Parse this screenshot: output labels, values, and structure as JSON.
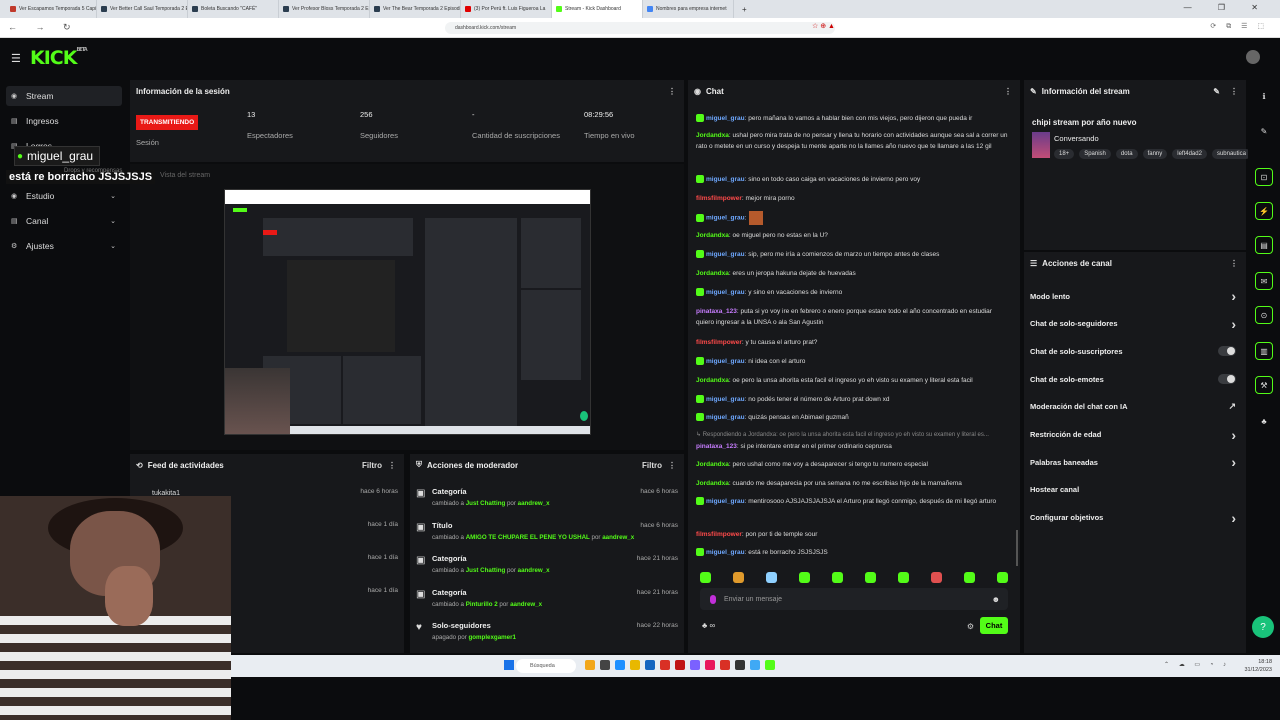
{
  "browser": {
    "tabs": [
      {
        "label": "Ver Escapamos Temporada 5 Capitulo",
        "color": "#c0392b"
      },
      {
        "label": "Ver Better Call Saul Temporada 2 Epi",
        "color": "#2c3e50"
      },
      {
        "label": "Boleta Buscando \"CAFÉ\"",
        "color": "#2c3e50"
      },
      {
        "label": "Ver Profesor Bloss Temporada 2 Epi",
        "color": "#2c3e50"
      },
      {
        "label": "Ver The Bear Temporada 2 Episodio",
        "color": "#2c3e50"
      },
      {
        "label": "(3) Por Perú ft. Luis Figueroa La",
        "color": "#e00000"
      },
      {
        "label": "Stream - Kick Dashboard",
        "color": "#53fc18",
        "active": true
      },
      {
        "label": "Nombres para empresa internet",
        "color": "#4285f4"
      }
    ],
    "new_tab": "+",
    "window_controls": "— ❐ ✕",
    "nav": "← → ↻",
    "url": "dashboard.kick.com/stream",
    "address_icons": "☆ ⊕ ▲",
    "extension_icons": "⟳ ⧉ ☰ ⬚"
  },
  "header": {
    "menu_icon": "☰",
    "logo": "KICK",
    "logo_sup": "BETA"
  },
  "sidebar": {
    "items": [
      {
        "label": "Stream",
        "icon": "◉",
        "selected": true,
        "chevron": ""
      },
      {
        "label": "Ingresos",
        "icon": "▤",
        "selected": false,
        "chevron": ""
      },
      {
        "label": "Logros",
        "icon": "▤",
        "selected": false,
        "chevron": ""
      },
      {
        "label": "Estudio",
        "icon": "◉",
        "selected": false,
        "chevron": "⌄"
      },
      {
        "label": "Canal",
        "icon": "▤",
        "selected": false,
        "chevron": "⌄"
      },
      {
        "label": "Ajustes",
        "icon": "⚙",
        "selected": false,
        "chevron": "⌄"
      }
    ]
  },
  "overlay": {
    "username": "miguel_grau",
    "message": "está re borracho JSJSJSJS",
    "partial_label": "Drops y recompensas",
    "partial_label2": "Vista del stream"
  },
  "session": {
    "title": "Información de la sesión",
    "menu": "⋮",
    "live_badge": "TRANSMITIENDO",
    "live_label": "Sesión",
    "stats": [
      {
        "value": "13",
        "label": "Espectadores"
      },
      {
        "value": "256",
        "label": "Seguidores"
      },
      {
        "value": "-",
        "label": "Cantidad de suscripciones"
      },
      {
        "value": "08:29:56",
        "label": "Tiempo en vivo"
      }
    ]
  },
  "feed": {
    "title": "Feed de actividades",
    "filter": "Filtro",
    "menu": "⋮",
    "rows": [
      {
        "name": "tukakita1",
        "time": "hace 6 horas"
      },
      {
        "name": "",
        "time": "hace 1 día"
      },
      {
        "name": "",
        "time": "hace 1 día"
      },
      {
        "name": "",
        "time": "hace 1 día"
      }
    ]
  },
  "moderator": {
    "title": "Acciones de moderador",
    "filter": "Filtro",
    "menu": "⋮",
    "rows": [
      {
        "icon": "▣",
        "title": "Categoría",
        "pre": "cambiado a ",
        "value": "Just Chatting",
        "mid": " por ",
        "user": "aandrew_x",
        "time": "hace 6 horas"
      },
      {
        "icon": "▣",
        "title": "Título",
        "pre": "cambiado a ",
        "value": "AMIGO TE CHUPARE EL PENE YO USHAL",
        "mid": " por ",
        "user": "aandrew_x",
        "time": "hace 6 horas"
      },
      {
        "icon": "▣",
        "title": "Categoría",
        "pre": "cambiado a ",
        "value": "Just Chatting",
        "mid": " por ",
        "user": "aandrew_x",
        "time": "hace 21 horas"
      },
      {
        "icon": "▣",
        "title": "Categoría",
        "pre": "cambiado a ",
        "value": "Pinturillo 2",
        "mid": " por ",
        "user": "aandrew_x",
        "time": "hace 21 horas"
      },
      {
        "icon": "♥",
        "title": "Solo-seguidores",
        "pre": "apagado por ",
        "value": "gomplexgamer1",
        "mid": "",
        "user": "",
        "time": "hace 22 horas"
      }
    ]
  },
  "chat": {
    "title": "Chat",
    "menu": "⋮",
    "messages": [
      {
        "user": "miguel_grau",
        "color": "#6ea8ff",
        "badge": true,
        "text": ": pero mañana lo vamos a hablar bien con mis viejos, pero dijeron que pueda ir"
      },
      {
        "user": "Jordandxa",
        "color": "#53fc18",
        "badge": false,
        "text": ": ushal pero mira trata de no pensar y llena tu horario con actividades aunque sea sal a correr un rato o metete en un curso y despeja tu mente aparte no la llames año nuevo que te llamare a las 12 gil"
      },
      {
        "user": "miguel_grau",
        "color": "#6ea8ff",
        "badge": true,
        "text": ": sino en todo caso caiga en vacaciones de invierno pero voy"
      },
      {
        "user": "filmsfilmpower",
        "color": "#ff4a4a",
        "badge": false,
        "text": ": mejor mira porno"
      },
      {
        "user": "miguel_grau",
        "color": "#6ea8ff",
        "badge": true,
        "text": ":"
      },
      {
        "user": "Jordandxa",
        "color": "#53fc18",
        "badge": false,
        "text": ": oe miguel pero no estas en la U?"
      },
      {
        "user": "miguel_grau",
        "color": "#6ea8ff",
        "badge": true,
        "text": ": sip, pero me iría a comienzos de marzo un tiempo antes de clases"
      },
      {
        "user": "Jordandxa",
        "color": "#53fc18",
        "badge": false,
        "text": ": eres un jeropa hakuna dejate de huevadas"
      },
      {
        "user": "miguel_grau",
        "color": "#6ea8ff",
        "badge": true,
        "text": ": y sino en vacaciones de invierno"
      },
      {
        "user": "pinataxa_123",
        "color": "#c77dff",
        "badge": false,
        "text": ": puta si yo voy ire en febrero o enero porque estare todo el año concentrado en estudiar quiero ingresar a la UNSA o ala San Agustin"
      },
      {
        "user": "filmsfilmpower",
        "color": "#ff4a4a",
        "badge": false,
        "text": ": y tu causa el arturo prat?"
      },
      {
        "user": "miguel_grau",
        "color": "#6ea8ff",
        "badge": true,
        "text": ": ni idea con el arturo"
      },
      {
        "user": "Jordandxa",
        "color": "#53fc18",
        "badge": false,
        "text": ": oe pero la unsa ahorita esta facil el ingreso yo eh visto su examen y literal esta facil"
      },
      {
        "user": "miguel_grau",
        "color": "#6ea8ff",
        "badge": true,
        "text": ": no podés tener el número de Arturo prat down xd"
      },
      {
        "user": "miguel_grau",
        "color": "#6ea8ff",
        "badge": true,
        "text": ": quizás pensas en Abimael guzmañ"
      },
      {
        "user": "pinataxa_123",
        "color": "#c77dff",
        "badge": false,
        "text": ": si pe intentare entrar en el primer ordinario ceprunsa",
        "reply": "↳ Respondiendo a Jordandxa: oe pero la unsa ahorita esta facil el ingreso yo eh visto su examen y literal es..."
      },
      {
        "user": "Jordandxa",
        "color": "#53fc18",
        "badge": false,
        "text": ": pero ushal como me voy a desaparecer si tengo tu numero especial"
      },
      {
        "user": "Jordandxa",
        "color": "#53fc18",
        "badge": false,
        "text": ": cuando me desaparecia por una semana no me escribias hijo de la mamañema"
      },
      {
        "user": "miguel_grau",
        "color": "#6ea8ff",
        "badge": true,
        "text": ": mentirosooo AJSJAJSJAJSJA el Arturo prat llegó conmigo, después de mi llegó arturo"
      },
      {
        "user": "filmsfilmpower",
        "color": "#ff4a4a",
        "badge": false,
        "text": ": pon por ti de temple sour"
      },
      {
        "user": "miguel_grau",
        "color": "#6ea8ff",
        "badge": true,
        "text": ": está re borracho JSJSJSJS"
      }
    ],
    "input_placeholder": "Enviar un mensaje",
    "emoji_icon": "☻",
    "bottom_left": "♣ ∞",
    "gear_icon": "⚙",
    "send_label": "Chat"
  },
  "stream_info": {
    "title": "Información del stream",
    "edit_icon": "✎",
    "menu": "⋮",
    "stream_title": "chipi stream por año nuevo",
    "category": "Conversando",
    "tags": [
      "18+",
      "Spanish",
      "dota",
      "fanny",
      "left4dad2",
      "subnautica"
    ]
  },
  "channel_actions": {
    "title": "Acciones de canal",
    "menu": "⋮",
    "rows": [
      {
        "label": "Modo lento",
        "control": "chevron"
      },
      {
        "label": "Chat de solo-seguidores",
        "control": "chevron"
      },
      {
        "label": "Chat de solo-suscriptores",
        "control": "toggle"
      },
      {
        "label": "Chat de solo-emotes",
        "control": "toggle"
      },
      {
        "label": "Moderación del chat con IA",
        "control": "external"
      },
      {
        "label": "Restricción de edad",
        "control": "chevron"
      },
      {
        "label": "Palabras baneadas",
        "control": "chevron"
      },
      {
        "label": "Hostear canal",
        "control": "none"
      },
      {
        "label": "Configurar objetivos",
        "control": "chevron"
      }
    ]
  },
  "rail": {
    "buttons": [
      "ℹ",
      "✎",
      "⊡",
      "⚡",
      "▤",
      "✉",
      "⊙",
      "▥",
      "⚒",
      "♣"
    ],
    "help": "?"
  },
  "taskbar": {
    "search": "Búsqueda",
    "time": "18:18",
    "date": "31/12/2023",
    "tray": "⌃ ☁ ▭ ◔ ♪"
  },
  "colors": {
    "accent": "#53fc18",
    "live": "#e91916",
    "panel": "#17181b",
    "background": "#0b0c0e"
  }
}
